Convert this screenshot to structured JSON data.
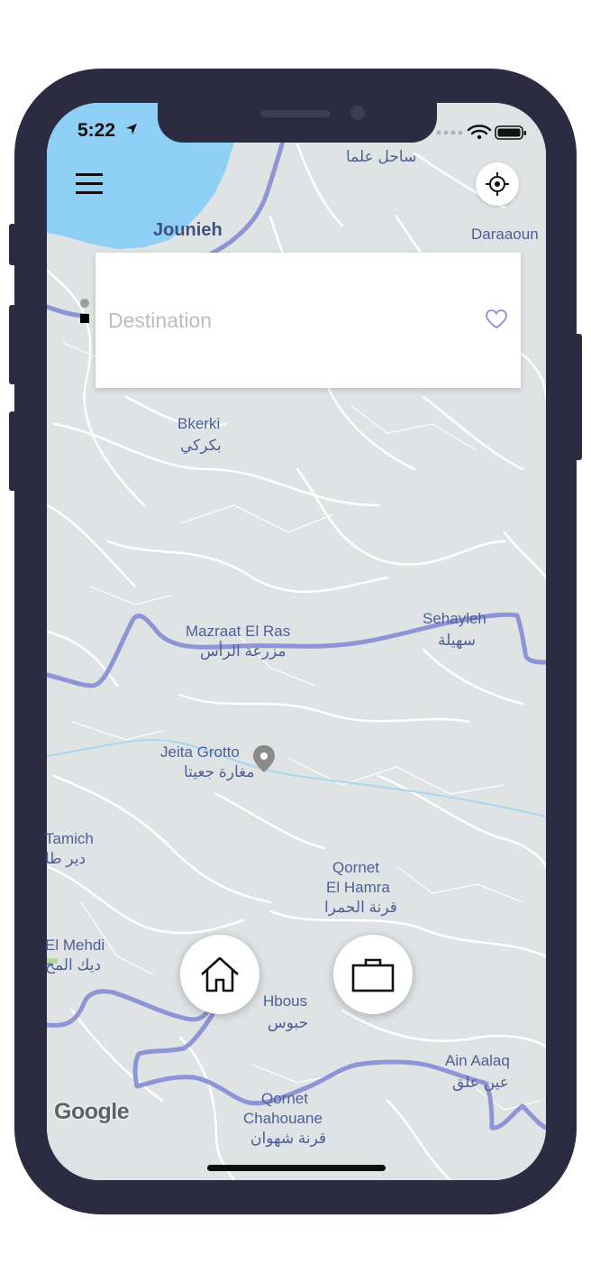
{
  "status_bar": {
    "time": "5:22",
    "icons": [
      "location-arrow-icon",
      "signal-dots-icon",
      "wifi-icon",
      "battery-icon"
    ]
  },
  "header": {
    "menu_icon": "hamburger-menu-icon",
    "locate_icon": "crosshair-icon"
  },
  "destination": {
    "placeholder": "Destination",
    "value": "",
    "favorite_icon": "heart-outline-icon"
  },
  "map": {
    "labels": {
      "sahel_alma_ar": "ساحل علما",
      "jounieh": "Jounieh",
      "daraaoun": "Daraaoun",
      "bkerki": "Bkerki",
      "bkerki_ar": "بكركي",
      "mazraat": "Mazraat El Ras",
      "mazraat_ar": "مزرعة الرأس",
      "sehayleh": "Sehayleh",
      "sehayleh_ar": "سهيلة",
      "jeita": "Jeita Grotto",
      "jeita_ar": "مغارة جعيتا",
      "tamich": "Tamich",
      "tamich_ar": "دير طا",
      "qornet_hamra_1": "Qornet",
      "qornet_hamra_2": "El Hamra",
      "qornet_hamra_ar": "قرنة الحمرا",
      "el_mehdi": "El Mehdi",
      "el_mehdi_ar": "ديك المح",
      "hbous": "Hbous",
      "hbous_ar": "حبوس",
      "ain_aalaq": "Ain Aalaq",
      "ain_aalaq_ar": "عين علق",
      "qornet_chahouane_1": "Qornet",
      "qornet_chahouane_2": "Chahouane",
      "qornet_chahouane_ar": "قرنة شهوان"
    },
    "attribution": "Google",
    "colors": {
      "land": "#dfe3e4",
      "water": "#8ecff5",
      "road": "#ffffff",
      "highway": "#8e95d6"
    }
  },
  "shortcuts": {
    "home_icon": "home-icon",
    "work_icon": "briefcase-icon"
  }
}
